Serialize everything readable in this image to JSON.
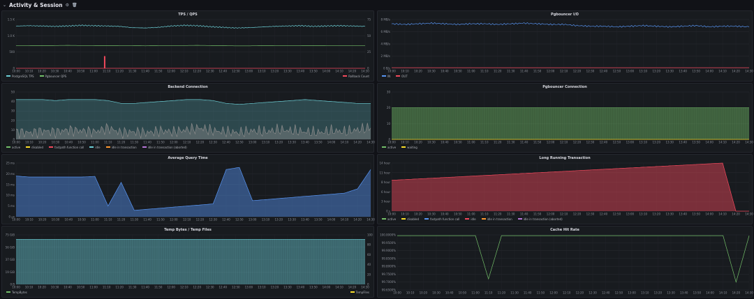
{
  "row_title": "Activity & Session",
  "icons": {
    "collapse": "chevron-down-icon",
    "settings": "gear-icon",
    "delete": "trash-icon"
  },
  "time_ticks": [
    "10:00",
    "10:10",
    "10:20",
    "10:30",
    "10:40",
    "10:50",
    "11:00",
    "11:10",
    "11:20",
    "11:30",
    "11:40",
    "11:50",
    "12:00",
    "12:10",
    "12:20",
    "12:30",
    "12:40",
    "12:50",
    "13:00",
    "13:10",
    "13:20",
    "13:30",
    "13:40",
    "13:50",
    "14:00",
    "14:10",
    "14:20",
    "14:30"
  ],
  "panels": [
    {
      "id": "tps",
      "title": "TPS / QPS",
      "yticks": [
        "1.5 K",
        "1.0 K",
        "500",
        "0"
      ],
      "y2ticks": [
        "75",
        "50",
        "25",
        "0"
      ],
      "legend": [
        {
          "label": "PostgreSQL TPS",
          "color": "#6ccfd6"
        },
        {
          "label": "Pgbouncer QPS",
          "color": "#73bf69"
        }
      ],
      "legend_right": [
        {
          "label": "Rollback Count",
          "color": "#f2495c"
        }
      ],
      "chart_data": {
        "type": "line",
        "x_range": [
          "10:00",
          "14:30"
        ],
        "ylim": [
          0,
          1500
        ],
        "y2lim": [
          0,
          100
        ],
        "series": [
          {
            "name": "PostgreSQL TPS",
            "values": [
              1300,
              1310,
              1300,
              1290,
              1300,
              1320,
              1310,
              1300,
              1290,
              1250,
              1240,
              1260,
              1300,
              1320,
              1310,
              1280,
              1260,
              1240,
              1250,
              1270,
              1290,
              1300,
              1310,
              1290,
              1300,
              1310,
              1300,
              1290
            ]
          },
          {
            "name": "Pgbouncer QPS",
            "values": [
              700,
              700,
              695,
              700,
              705,
              700,
              700,
              695,
              700,
              700,
              690,
              700,
              700,
              700,
              705,
              700,
              695,
              690,
              690,
              695,
              700,
              700,
              700,
              695,
              700,
              700,
              700,
              700
            ]
          },
          {
            "name": "Rollback Count",
            "values": [
              0,
              0,
              0,
              0,
              0,
              0,
              0,
              0,
              0,
              0,
              0,
              0,
              0,
              0,
              0,
              0,
              0,
              0,
              0,
              0,
              0,
              0,
              0,
              0,
              0,
              0,
              0,
              0
            ],
            "spike": {
              "x": "11:08",
              "value": 25
            }
          }
        ]
      }
    },
    {
      "id": "pgb_io",
      "title": "Pgbouncer I/O",
      "yticks": [
        "8 MB/s",
        "6 MB/s",
        "4 MB/s",
        "2 MB/s",
        "0 B/s"
      ],
      "legend": [
        {
          "label": "IN",
          "color": "#5794f2"
        },
        {
          "label": "OUT",
          "color": "#f2495c"
        }
      ],
      "chart_data": {
        "type": "line",
        "x_range": [
          "10:00",
          "14:30"
        ],
        "ylim": [
          0,
          8
        ],
        "series": [
          {
            "name": "IN",
            "values": [
              7.3,
              7.2,
              7.3,
              7.4,
              7.3,
              7.2,
              7.3,
              7.3,
              7.2,
              7.3,
              7.4,
              7.3,
              7.2,
              7.2,
              7.0,
              6.9,
              6.9,
              6.8,
              6.9,
              7.0,
              6.9,
              6.8,
              6.9,
              7.0,
              6.8,
              6.9,
              6.9,
              6.8
            ]
          },
          {
            "name": "OUT",
            "values": [
              0.1,
              0.1,
              0.1,
              0.1,
              0.1,
              0.1,
              0.1,
              0.1,
              0.1,
              0.1,
              0.1,
              0.1,
              0.1,
              0.1,
              0.1,
              0.1,
              0.1,
              0.1,
              0.1,
              0.1,
              0.1,
              0.1,
              0.1,
              0.1,
              0.1,
              0.1,
              0.1,
              0.1
            ]
          }
        ]
      }
    },
    {
      "id": "backend_conn",
      "title": "Backend Connection",
      "yticks": [
        "50",
        "40",
        "30",
        "20",
        "10",
        "0"
      ],
      "legend": [
        {
          "label": "active",
          "color": "#73bf69"
        },
        {
          "label": "disabled",
          "color": "#fade2a"
        },
        {
          "label": "fastpath function call",
          "color": "#f2495c"
        },
        {
          "label": "idle",
          "color": "#6ccfd6"
        },
        {
          "label": "idle in transaction",
          "color": "#ff9830"
        },
        {
          "label": "idle in transaction (aborted)",
          "color": "#b877d9"
        }
      ],
      "chart_data": {
        "type": "area",
        "x_range": [
          "10:00",
          "14:30"
        ],
        "ylim": [
          0,
          50
        ],
        "series": [
          {
            "name": "idle",
            "values": [
              42,
              42,
              42,
              41,
              42,
              42,
              42,
              41,
              38,
              38,
              39,
              40,
              41,
              42,
              42,
              41,
              38,
              37,
              38,
              39,
              40,
              41,
              42,
              41,
              40,
              39,
              38,
              38
            ]
          },
          {
            "name": "active",
            "values": [
              8,
              7,
              9,
              8,
              10,
              9,
              8,
              12,
              7,
              8,
              7,
              9,
              8,
              10,
              12,
              9,
              8,
              7,
              9,
              8,
              10,
              9,
              8,
              7,
              9,
              8,
              10,
              12
            ]
          }
        ]
      }
    },
    {
      "id": "pgb_conn",
      "title": "Pgbouncer Connection",
      "yticks": [
        "30",
        "20",
        "10",
        "0"
      ],
      "legend": [
        {
          "label": "active",
          "color": "#73bf69"
        },
        {
          "label": "waiting",
          "color": "#fade2a"
        }
      ],
      "chart_data": {
        "type": "area",
        "x_range": [
          "10:00",
          "14:30"
        ],
        "ylim": [
          0,
          30
        ],
        "series": [
          {
            "name": "active",
            "values": [
              20,
              20,
              20,
              20,
              20,
              20,
              20,
              20,
              20,
              20,
              20,
              20,
              20,
              20,
              20,
              20,
              20,
              20,
              20,
              20,
              20,
              20,
              20,
              20,
              20,
              20,
              20,
              20
            ]
          },
          {
            "name": "waiting",
            "values": [
              0,
              0,
              0,
              0,
              0,
              0,
              0,
              0,
              0,
              0,
              0,
              0,
              0,
              0,
              0,
              0,
              0,
              0,
              0,
              0,
              0,
              0,
              0,
              0,
              0,
              0,
              0,
              0
            ]
          }
        ]
      }
    },
    {
      "id": "avg_query",
      "title": "Average Query Time",
      "yticks": [
        "25 ms",
        "20 ms",
        "15 ms",
        "10 ms",
        "5 ms",
        "0 µs"
      ],
      "legend": [],
      "chart_data": {
        "type": "area",
        "x_range": [
          "10:00",
          "14:30"
        ],
        "ylim": [
          0,
          25
        ],
        "series": [
          {
            "name": "",
            "values": [
              19,
              18.5,
              18.5,
              18.5,
              18.5,
              18.5,
              18.8,
              5,
              16,
              3,
              3.5,
              4,
              4.5,
              5,
              5.5,
              6,
              22,
              23,
              7.5,
              8,
              8.5,
              9,
              9.5,
              10,
              10.5,
              11,
              13,
              22
            ]
          }
        ]
      }
    },
    {
      "id": "long_tx",
      "title": "Long Running Transaction",
      "yticks": [
        "14 hour",
        "11 hour",
        "8 hour",
        "6 hour",
        "3 hour",
        "0 s"
      ],
      "legend": [
        {
          "label": "active",
          "color": "#73bf69"
        },
        {
          "label": "disabled",
          "color": "#fade2a"
        },
        {
          "label": "fastpath function call",
          "color": "#5794f2"
        },
        {
          "label": "idle",
          "color": "#f2495c"
        },
        {
          "label": "idle in transaction",
          "color": "#ff9830"
        },
        {
          "label": "idle in transaction (aborted)",
          "color": "#b877d9"
        }
      ],
      "chart_data": {
        "type": "area",
        "x_range": [
          "10:00",
          "14:30"
        ],
        "ylim": [
          0,
          14
        ],
        "series": [
          {
            "name": "idle",
            "values": [
              9.0,
              9.2,
              9.4,
              9.6,
              9.8,
              10.0,
              10.2,
              10.4,
              10.6,
              10.8,
              11.0,
              11.2,
              11.4,
              11.6,
              11.8,
              12.0,
              12.2,
              12.4,
              12.6,
              12.8,
              13.0,
              13.2,
              13.4,
              13.6,
              13.8,
              14.0,
              0,
              0
            ]
          }
        ]
      }
    },
    {
      "id": "temp",
      "title": "Temp Bytes / Temp Files",
      "yticks": [
        "75 GiB",
        "56 GiB",
        "37 GiB",
        "19 GiB",
        "0 B"
      ],
      "y2ticks": [
        "100",
        "80",
        "60",
        "40",
        "20",
        "0"
      ],
      "legend": [
        {
          "label": "TempBytes",
          "color": "#73bf69"
        }
      ],
      "legend_right": [
        {
          "label": "TempFiles",
          "color": "#fade2a"
        }
      ],
      "chart_data": {
        "type": "area",
        "x_range": [
          "10:00",
          "14:30"
        ],
        "ylim": [
          0,
          75
        ],
        "series": [
          {
            "name": "TempBytes",
            "values": [
              68,
              68,
              68,
              68,
              68,
              68,
              68,
              68,
              68,
              68,
              68,
              68,
              68,
              68,
              68,
              68,
              68,
              68,
              68,
              68,
              68,
              68,
              68,
              68,
              68,
              68,
              68,
              68
            ]
          }
        ]
      }
    },
    {
      "id": "cache_hit",
      "title": "Cache Hit Rate",
      "yticks": [
        "100.0000%",
        "99.9500%",
        "99.9000%",
        "99.8500%",
        "99.8000%",
        "99.7500%",
        "99.7000%",
        "99.6500%"
      ],
      "legend": [],
      "chart_data": {
        "type": "line",
        "x_range": [
          "10:00",
          "14:30"
        ],
        "ylim": [
          99.65,
          100.0
        ],
        "series": [
          {
            "name": "",
            "values": [
              99.995,
              99.995,
              99.995,
              99.995,
              99.995,
              99.995,
              99.995,
              99.72,
              99.995,
              99.995,
              99.995,
              99.995,
              99.995,
              99.995,
              99.995,
              99.995,
              99.995,
              99.995,
              99.995,
              99.995,
              99.995,
              99.995,
              99.995,
              99.995,
              99.995,
              99.995,
              99.7,
              99.995
            ]
          }
        ]
      }
    }
  ]
}
